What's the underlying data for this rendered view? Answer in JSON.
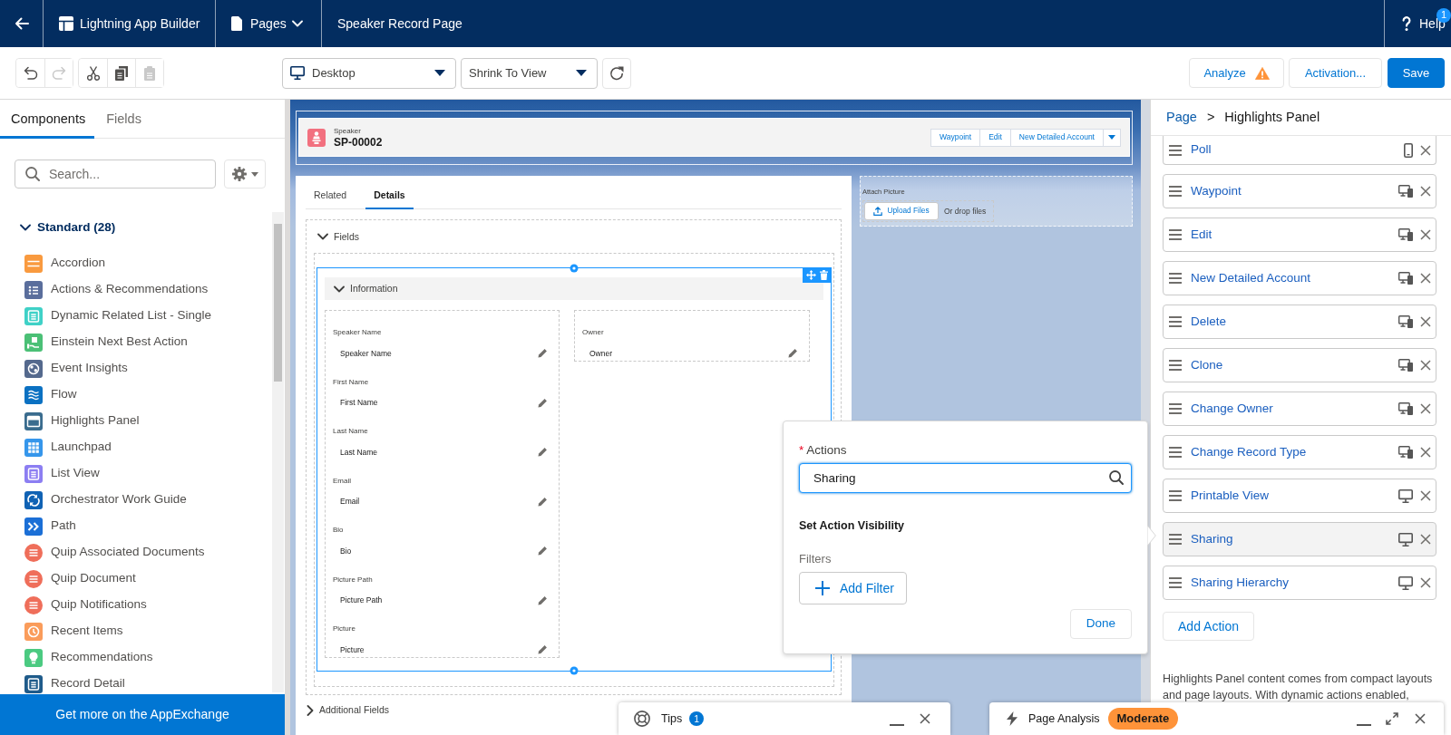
{
  "top_bar": {
    "app_title": "Lightning App Builder",
    "pages_menu": "Pages",
    "page_title": "Speaker Record Page",
    "help": {
      "label": "Help",
      "badge": "1"
    }
  },
  "toolbar": {
    "tools": [
      {
        "kind": "undo",
        "disabled": false
      },
      {
        "kind": "redo",
        "disabled": true
      },
      {
        "kind": "cut",
        "disabled": false
      },
      {
        "kind": "copy",
        "disabled": false
      },
      {
        "kind": "paste",
        "disabled": true
      }
    ],
    "device_select": {
      "value": "Desktop"
    },
    "zoom_select": {
      "value": "Shrink To View"
    },
    "analyze": {
      "label": "Analyze",
      "warning": true
    },
    "activation": "Activation...",
    "save": "Save"
  },
  "left_panel": {
    "tabs": [
      {
        "label": "Components",
        "selected": true
      },
      {
        "label": "Fields",
        "selected": false
      }
    ],
    "search": {
      "placeholder": "Search..."
    },
    "group": {
      "label": "Standard (28)",
      "expanded": true,
      "items": [
        {
          "label": "Accordion",
          "kind": "rows",
          "color": "#f99a3f"
        },
        {
          "label": "Actions & Recommendations",
          "kind": "checklist",
          "color": "#5a6e9c"
        },
        {
          "label": "Dynamic Related List - Single",
          "kind": "list",
          "color": "#3fd1c7"
        },
        {
          "label": "Einstein Next Best Action",
          "kind": "hand",
          "color": "#4bc076"
        },
        {
          "label": "Event Insights",
          "kind": "nodes",
          "color": "#54698d"
        },
        {
          "label": "Flow",
          "kind": "waves",
          "color": "#0b71c2"
        },
        {
          "label": "Highlights Panel",
          "kind": "panel",
          "color": "#3a6c8e"
        },
        {
          "label": "Launchpad",
          "kind": "grid",
          "color": "#3596eb"
        },
        {
          "label": "List View",
          "kind": "list",
          "color": "#8c7ef2"
        },
        {
          "label": "Orchestrator Work Guide",
          "kind": "arrows",
          "color": "#1062b4"
        },
        {
          "label": "Path",
          "kind": "chevrons",
          "color": "#1b6fd6"
        },
        {
          "label": "Quip Associated Documents",
          "kind": "bubble",
          "color": "#ef6e5a"
        },
        {
          "label": "Quip Document",
          "kind": "bubble",
          "color": "#ef6e5a"
        },
        {
          "label": "Quip Notifications",
          "kind": "bubble",
          "color": "#ef6e5a"
        },
        {
          "label": "Recent Items",
          "kind": "clock",
          "color": "#fa9c5b"
        },
        {
          "label": "Recommendations",
          "kind": "bulb",
          "color": "#4bca81"
        },
        {
          "label": "Record Detail",
          "kind": "list",
          "color": "#1f5b8a"
        }
      ]
    },
    "appexchange": "Get more on the AppExchange"
  },
  "canvas": {
    "highlights_panel": {
      "object_label": "Speaker",
      "record_name": "SP-00002",
      "actions": [
        "Waypoint",
        "Edit",
        "New Detailed Account"
      ]
    },
    "tabs": [
      {
        "label": "Related",
        "selected": false
      },
      {
        "label": "Details",
        "selected": true
      }
    ],
    "fields_section": {
      "label": "Fields",
      "expanded": true
    },
    "information_section": {
      "label": "Information",
      "expanded": true,
      "selected": true,
      "columns": [
        {
          "fields": [
            {
              "label": "Speaker Name",
              "value": "Speaker Name"
            },
            {
              "label": "First Name",
              "value": "First Name"
            },
            {
              "label": "Last Name",
              "value": "Last Name"
            },
            {
              "label": "Email",
              "value": "Email"
            },
            {
              "label": "Bio",
              "value": "Bio"
            },
            {
              "label": "Picture Path",
              "value": "Picture Path"
            },
            {
              "label": "Picture",
              "value": "Picture"
            }
          ]
        },
        {
          "fields": [
            {
              "label": "Owner",
              "value": "Owner"
            }
          ]
        }
      ]
    },
    "additional_fields": {
      "label": "Additional Fields",
      "expanded": false
    },
    "attach_picture": {
      "label": "Attach Picture",
      "button": "Upload Files",
      "hint": "Or drop files"
    }
  },
  "action_popover": {
    "required_mark": "*",
    "label": "Actions",
    "search": {
      "value": "Sharing"
    },
    "visibility_heading": "Set Action Visibility",
    "filters_label": "Filters",
    "add_filter": "Add Filter",
    "done": "Done"
  },
  "properties_panel": {
    "breadcrumb": {
      "parent": "Page",
      "separator": ">",
      "current": "Highlights Panel"
    },
    "actions": [
      {
        "label": "Poll",
        "kind": "phone",
        "selected": false
      },
      {
        "label": "Waypoint",
        "kind": "desktop_and_phone",
        "selected": false
      },
      {
        "label": "Edit",
        "kind": "desktop_and_phone",
        "selected": false
      },
      {
        "label": "New Detailed Account",
        "kind": "desktop_and_phone",
        "selected": false
      },
      {
        "label": "Delete",
        "kind": "desktop_and_phone",
        "selected": false
      },
      {
        "label": "Clone",
        "kind": "desktop_and_phone",
        "selected": false
      },
      {
        "label": "Change Owner",
        "kind": "desktop_and_phone",
        "selected": false
      },
      {
        "label": "Change Record Type",
        "kind": "desktop_and_phone",
        "selected": false
      },
      {
        "label": "Printable View",
        "kind": "desktop",
        "selected": false
      },
      {
        "label": "Sharing",
        "kind": "desktop",
        "selected": true
      },
      {
        "label": "Sharing Hierarchy",
        "kind": "desktop",
        "selected": false
      }
    ],
    "add_action": "Add Action",
    "description": "Highlights Panel content comes from compact layouts and page layouts. With dynamic actions enabled,"
  },
  "tips_panel": {
    "label": "Tips",
    "badge": "1"
  },
  "page_analysis_panel": {
    "label": "Page Analysis",
    "status": "Moderate"
  }
}
